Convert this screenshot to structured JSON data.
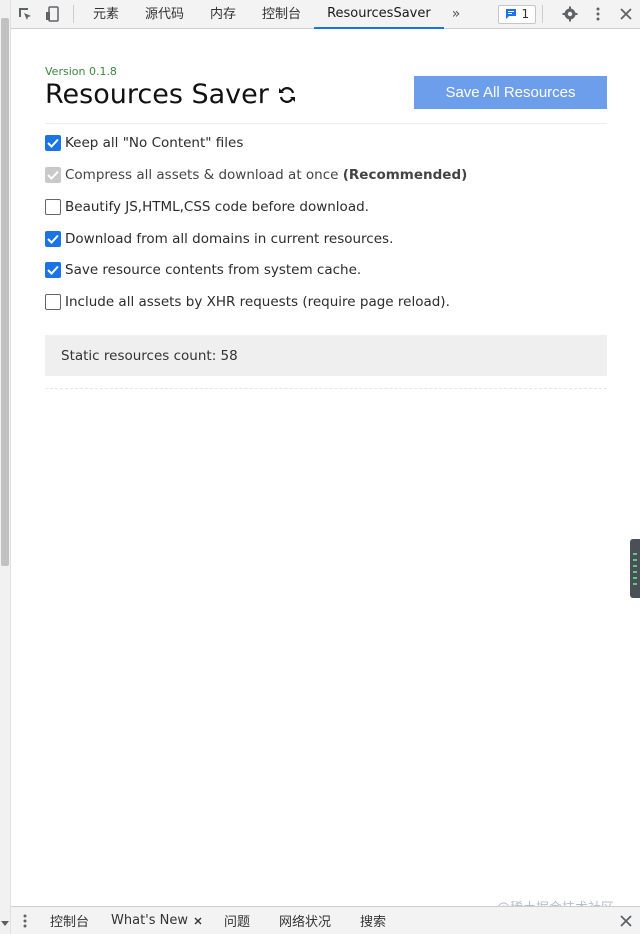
{
  "toolbar": {
    "tabs": [
      "元素",
      "源代码",
      "内存",
      "控制台",
      "ResourcesSaver"
    ],
    "more_tabs": "»",
    "issues_count": "1"
  },
  "panel": {
    "version": "Version 0.1.8",
    "title": "Resources Saver",
    "save_button": "Save All Resources",
    "options": [
      {
        "label": "Keep all \"No Content\" files",
        "checked": true
      },
      {
        "label": "Compress all assets & download at once ",
        "bold": "(Recommended)",
        "checked": true,
        "disabled": true
      },
      {
        "label": "Beautify JS,HTML,CSS code before download.",
        "checked": false
      },
      {
        "label": "Download from all domains in current resources.",
        "checked": true
      },
      {
        "label": "Save resource contents from system cache.",
        "checked": true
      },
      {
        "label": "Include all assets by XHR requests (require page reload).",
        "checked": false
      }
    ],
    "status": "Static resources count: 58"
  },
  "drawer": {
    "tabs": [
      "控制台",
      "What's New",
      "问题",
      "网络状况",
      "搜索"
    ]
  },
  "watermark": "@稀土掘金技术社区",
  "colors": {
    "accent": "#1a73e8",
    "button": "#6d9eeb",
    "version": "#3a8a3a"
  }
}
